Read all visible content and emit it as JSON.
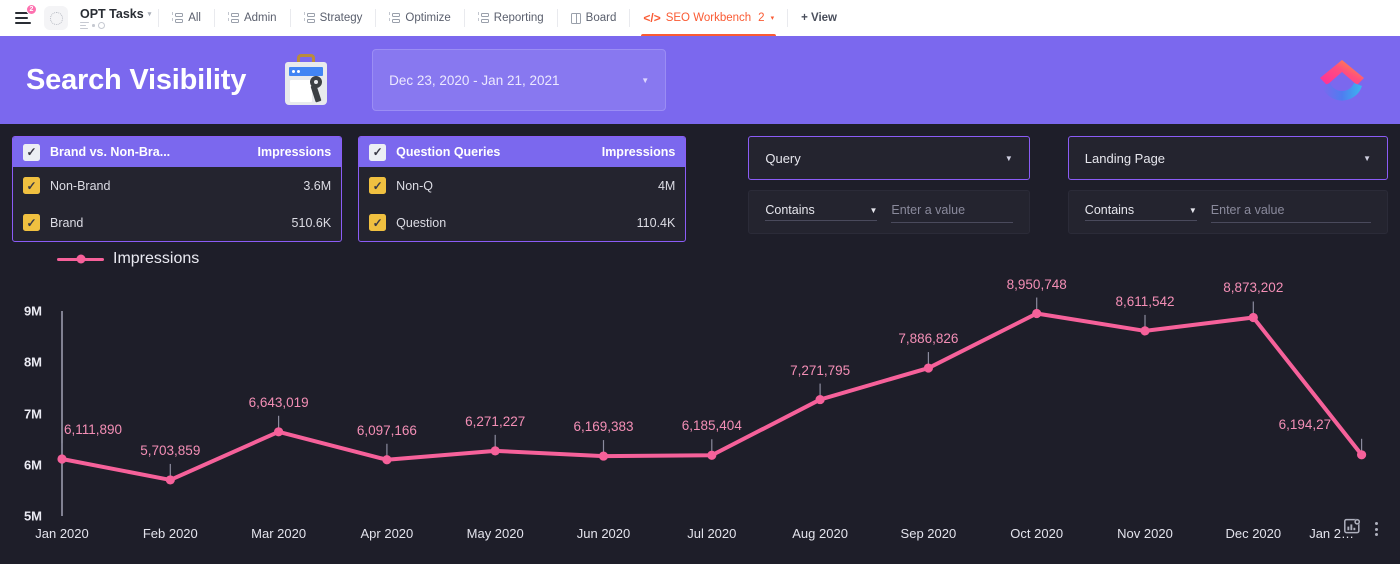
{
  "topnav": {
    "notification_count": "2",
    "space_name": "OPT Tasks",
    "items": [
      {
        "label": "All",
        "icon": "list-view-icon",
        "active": false
      },
      {
        "label": "Admin",
        "icon": "list-view-icon",
        "active": false
      },
      {
        "label": "Strategy",
        "icon": "list-view-icon",
        "active": false
      },
      {
        "label": "Optimize",
        "icon": "list-view-icon",
        "active": false
      },
      {
        "label": "Reporting",
        "icon": "list-view-icon",
        "active": false
      },
      {
        "label": "Board",
        "icon": "board-view-icon",
        "active": false
      }
    ],
    "active_tab": {
      "label": "SEO Workbench",
      "count": "2",
      "icon": "embed-code-icon"
    },
    "add_view": "+ View"
  },
  "banner": {
    "title": "Search Visibility",
    "icon": "google-search-console-icon",
    "date_range": "Dec 23, 2020 - Jan 21, 2021",
    "logo": "clickup-logo",
    "bg_color": "#7b68ee"
  },
  "filters": {
    "brand_card": {
      "header": {
        "label": "Brand vs. Non-Bra...",
        "metric": "Impressions",
        "checked": true
      },
      "rows": [
        {
          "label": "Non-Brand",
          "value": "3.6M",
          "checked": true
        },
        {
          "label": "Brand",
          "value": "510.6K",
          "checked": true
        }
      ]
    },
    "question_card": {
      "header": {
        "label": "Question Queries",
        "metric": "Impressions",
        "checked": true
      },
      "rows": [
        {
          "label": "Non-Q",
          "value": "4M",
          "checked": true
        },
        {
          "label": "Question",
          "value": "110.4K",
          "checked": true
        }
      ]
    },
    "query_filter": {
      "dimension": "Query",
      "operator": "Contains",
      "value": "",
      "placeholder": "Enter a value"
    },
    "landing_filter": {
      "dimension": "Landing Page",
      "operator": "Contains",
      "value": "",
      "placeholder": "Enter a value"
    }
  },
  "chart_toolbar": {
    "settings_icon": "chart-settings-icon",
    "more_icon": "kebab-menu-icon"
  },
  "chart_data": {
    "type": "line",
    "title": "",
    "legend": [
      "Impressions"
    ],
    "legend_position": "top-left",
    "series_color": "#f6619a",
    "xlabel": "",
    "ylabel": "",
    "grid": false,
    "ylim": [
      5000000,
      9000000
    ],
    "ytick_labels": [
      "9M",
      "8M",
      "7M",
      "6M",
      "5M"
    ],
    "ytick_values": [
      9000000,
      8000000,
      7000000,
      6000000,
      5000000
    ],
    "categories": [
      "Jan 2020",
      "Feb 2020",
      "Mar 2020",
      "Apr 2020",
      "May 2020",
      "Jun 2020",
      "Jul 2020",
      "Aug 2020",
      "Sep 2020",
      "Oct 2020",
      "Nov 2020",
      "Dec 2020",
      "Jan 2…"
    ],
    "series": [
      {
        "name": "Impressions",
        "values": [
          6111890,
          5703859,
          6643019,
          6097166,
          6271227,
          6169383,
          6185404,
          7271795,
          7886826,
          8950748,
          8611542,
          8873202,
          6194270
        ],
        "data_labels": [
          "6,111,890",
          "5,703,859",
          "6,643,019",
          "6,097,166",
          "6,271,227",
          "6,169,383",
          "6,185,404",
          "7,271,795",
          "7,886,826",
          "8,950,748",
          "8,611,542",
          "8,873,202",
          "6,194,27"
        ]
      }
    ]
  }
}
